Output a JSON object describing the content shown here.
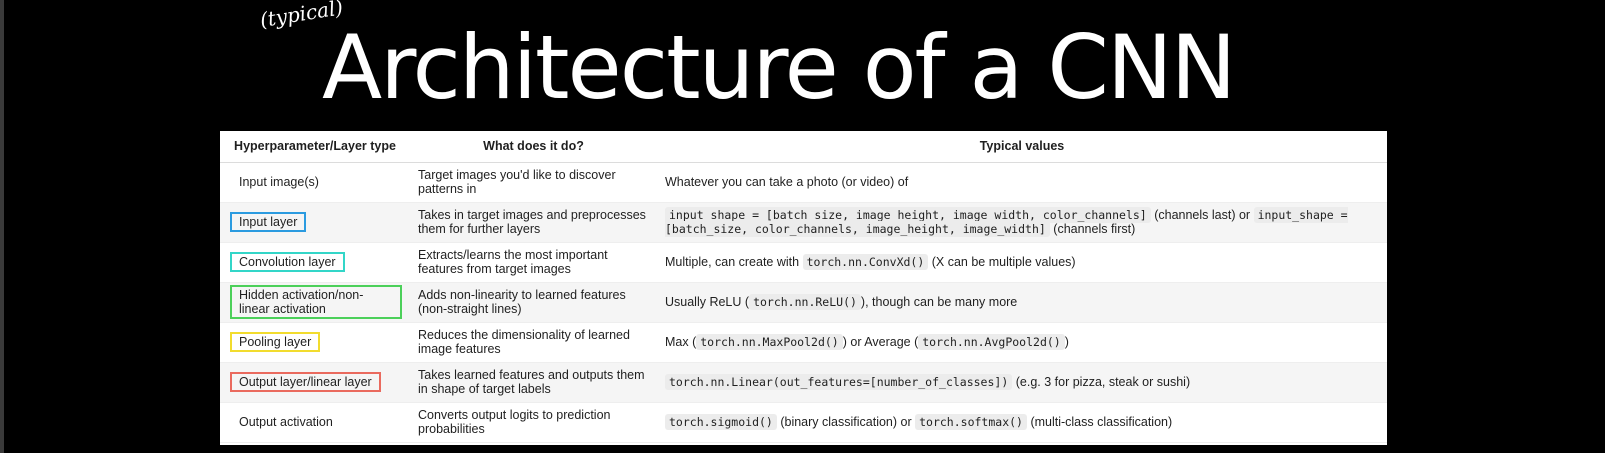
{
  "slide": {
    "title": "Architecture of a CNN",
    "annotation": "(typical)",
    "annotation_mark": "*"
  },
  "colors": {
    "background": "#000000",
    "title": "#ffffff",
    "box_input_layer": "#2b9be0",
    "box_convolution_layer": "#33d6c8",
    "box_hidden_activation": "#4cd05a",
    "box_pooling_layer": "#f2dc2e",
    "box_output_layer": "#ea6a5e"
  },
  "table": {
    "headers": [
      "Hyperparameter/Layer type",
      "What does it do?",
      "Typical values"
    ],
    "rows": [
      {
        "layer": "Input image(s)",
        "box_color": "",
        "description": "Target images you'd like to discover patterns in",
        "values": [
          {
            "text": "Whatever you can take a photo (or video) of",
            "code": false
          }
        ]
      },
      {
        "layer": "Input layer",
        "box_color": "#2b9be0",
        "description": "Takes in target images and preprocesses them for further layers",
        "values": [
          {
            "text": "input_shape = [batch_size, image_height, image_width, color_channels]",
            "code": true
          },
          {
            "text": " (channels last) or ",
            "code": false
          },
          {
            "text": "input_shape = [batch_size, color_channels, image_height, image_width]",
            "code": true
          },
          {
            "text": " (channels first)",
            "code": false
          }
        ]
      },
      {
        "layer": "Convolution layer",
        "box_color": "#33d6c8",
        "description": "Extracts/learns the most important features from target images",
        "values": [
          {
            "text": "Multiple, can create with ",
            "code": false
          },
          {
            "text": "torch.nn.ConvXd()",
            "code": true
          },
          {
            "text": " (X can be multiple values)",
            "code": false
          }
        ]
      },
      {
        "layer": "Hidden activation/non-linear activation",
        "box_color": "#4cd05a",
        "description": "Adds non-linearity to learned features (non-straight lines)",
        "values": [
          {
            "text": "Usually ReLU (",
            "code": false
          },
          {
            "text": "torch.nn.ReLU()",
            "code": true
          },
          {
            "text": "), though can be many more",
            "code": false
          }
        ]
      },
      {
        "layer": "Pooling layer",
        "box_color": "#f2dc2e",
        "description": "Reduces the dimensionality of learned image features",
        "values": [
          {
            "text": "Max (",
            "code": false
          },
          {
            "text": "torch.nn.MaxPool2d()",
            "code": true
          },
          {
            "text": ") or Average (",
            "code": false
          },
          {
            "text": "torch.nn.AvgPool2d()",
            "code": true
          },
          {
            "text": ")",
            "code": false
          }
        ]
      },
      {
        "layer": "Output layer/linear layer",
        "box_color": "#ea6a5e",
        "description": "Takes learned features and outputs them in shape of target labels",
        "values": [
          {
            "text": "torch.nn.Linear(out_features=[number_of_classes])",
            "code": true
          },
          {
            "text": " (e.g. 3 for pizza, steak or sushi)",
            "code": false
          }
        ]
      },
      {
        "layer": "Output activation",
        "box_color": "",
        "description": "Converts output logits to prediction probabilities",
        "values": [
          {
            "text": "torch.sigmoid()",
            "code": true
          },
          {
            "text": " (binary classification) or ",
            "code": false
          },
          {
            "text": "torch.softmax()",
            "code": true
          },
          {
            "text": " (multi-class classification)",
            "code": false
          }
        ]
      }
    ]
  }
}
